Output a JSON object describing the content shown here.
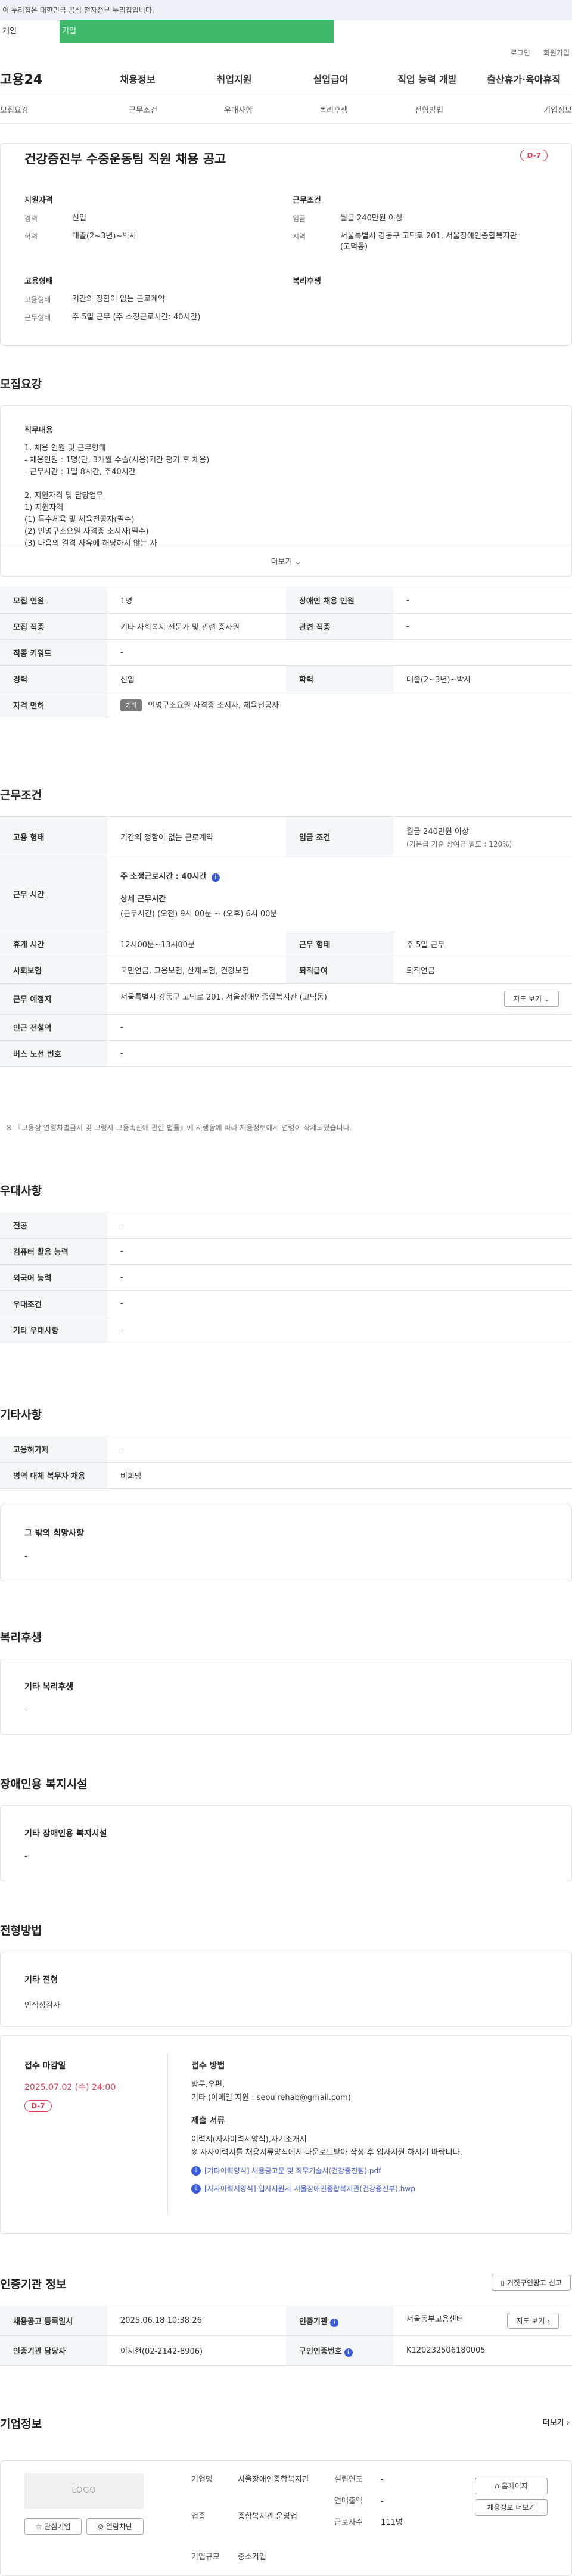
{
  "gov_banner": "이 누리집은 대한민국 공식 전자정부 누리집입니다.",
  "top_tabs": [
    "개인",
    "기업"
  ],
  "util_links": [
    "로그인",
    "회원가입"
  ],
  "brand": "고용24",
  "gnb": [
    "채용정보",
    "취업지원",
    "실업급여",
    "직업 능력 개발",
    "출산휴가·육아휴직"
  ],
  "anchors": [
    "모집요강",
    "근무조건",
    "우대사항",
    "복리후생",
    "전형방법",
    "기업정보"
  ],
  "summary": {
    "title": "건강증진부 수중운동팀 직원 채용 공고",
    "dday": "D-7",
    "qual_h": "지원자격",
    "career_k": "경력",
    "career_v": "신입",
    "edu_k": "학력",
    "edu_v": "대졸(2~3년)~박사",
    "cond_h": "근무조건",
    "wage_k": "임금",
    "wage_v": "월급 240만원 이상",
    "area_k": "지역",
    "area_v": "서울특별시 강동구 고덕로 201, 서울장애인종합복지관 (고덕동)",
    "emp_h": "고용형태",
    "emp_k": "고용형태",
    "emp_v": "기간의 정함이 없는 근로계약",
    "type_k": "근무형태",
    "type_v": "주 5일 근무 (주 소정근로시간: 40시간)",
    "welfare_h": "복리후생"
  },
  "recruit": {
    "title": "모집요강",
    "desc_label": "직무내용",
    "desc_lines": [
      "1. 채용 인원 및 근무형태",
      "- 채용인원 : 1명(단, 3개월 수습(시용)기간 평가 후 채용)",
      "- 근무시간 : 1일 8시간, 주40시간",
      "",
      "2. 지원자격 및 담당업무",
      "1) 지원자격",
      "(1) 특수체육 및 체육전공자(필수)",
      "(2) 인명구조요원 자격증 소지자(필수)",
      "(3) 다음의 결격 사유에 해당하지 않는 자"
    ],
    "more": "더보기",
    "rows": [
      {
        "k": "모집 인원",
        "v": "1명",
        "k2": "장애인 채용 인원",
        "v2": "-"
      },
      {
        "k": "모집 직종",
        "v": "기타 사회복지 전문가 및 관련 종사원",
        "k2": "관련 직종",
        "v2": "-"
      },
      {
        "k": "직종 키워드",
        "v": "-"
      },
      {
        "k": "경력",
        "v": "신입",
        "k2": "학력",
        "v2": "대졸(2~3년)~박사"
      }
    ],
    "license_k": "자격 면허",
    "license_badge": "기타",
    "license_v": "인명구조요원 자격증 소지자, 체육전공자"
  },
  "work": {
    "title": "근무조건",
    "emp_k": "고용 형태",
    "emp_v": "기간의 정함이 없는 근로계약",
    "wage_k": "임금 조건",
    "wage_v": "월급 240만원 이상",
    "wage_sub": "(기본급 기준 상여금 별도 : 120%)",
    "hours_k": "근무 시간",
    "hours_total": "주 소정근로시간 : 40시간",
    "hours_detail_h": "상세 근무시간",
    "hours_detail": "(근무시간) (오전) 9시 00분 ~ (오후) 6시 00분",
    "rest_k": "휴게 시간",
    "rest_v": "12시00분~13시00분",
    "type_k": "근무 형태",
    "type_v": "주 5일 근무",
    "ins_k": "사회보험",
    "ins_v": "국민연금, 고용보험, 산재보험, 건강보험",
    "ret_k": "퇴직급여",
    "ret_v": "퇴직연금",
    "place_k": "근무 예정지",
    "place_v": "서울특별시 강동구 고덕로 201, 서울장애인종합복지관 (고덕동)",
    "map_btn": "지도 보기",
    "subway_k": "인근 전철역",
    "subway_v": "-",
    "bus_k": "버스 노선 번호",
    "bus_v": "-",
    "note": "※ 『고용상 연령차별금지 및 고령자 고용촉진에 관한 법률』에 시행함에 따라 채용정보에서 연령이 삭제되었습니다."
  },
  "pref": {
    "title": "우대사항",
    "rows": [
      {
        "k": "전공",
        "v": "-"
      },
      {
        "k": "컴퓨터 활용 능력",
        "v": "-"
      },
      {
        "k": "외국어 능력",
        "v": "-"
      },
      {
        "k": "우대조건",
        "v": "-"
      },
      {
        "k": "기타 우대사항",
        "v": "-"
      }
    ]
  },
  "etc": {
    "title": "기타사항",
    "rows": [
      {
        "k": "고용허가제",
        "v": "-"
      },
      {
        "k": "병역 대체 복무자 채용",
        "v": "비희망"
      }
    ],
    "other_h": "그 밖의 희망사항",
    "other_v": "-"
  },
  "welfare": {
    "title": "복리후생",
    "h": "기타 복리후생",
    "v": "-"
  },
  "disabled": {
    "title": "장애인용 복지시설",
    "h": "기타 장애인용 복지시설",
    "v": "-"
  },
  "selection": {
    "title": "전형방법",
    "h": "기타 전형",
    "v": "인적성검사"
  },
  "apply": {
    "deadline_h": "접수 마감일",
    "deadline_v": "2025.07.02 (수) 24:00",
    "dday": "D-7",
    "method_h": "접수 방법",
    "method_v1": "방문,우편,",
    "method_v2": "기타 (이메일 지원 : seoulrehab@gmail.com)",
    "docs_h": "제출 서류",
    "docs_v1": "이력서(자사이력서양식),자기소개서",
    "docs_v2": "※ 자사이력서를 채용서류양식에서 다운로드받아 작성 후 입사지원 하시기 바랍니다.",
    "file1": "[기타이력양식] 채용공고문 및 직무기술서(건강증진팀).pdf",
    "file2": "[자사이력서양식] 입사지원서-서울장애인종합복지관(건강증진부).hwp"
  },
  "agency": {
    "title": "인증기관 정보",
    "report_btn": "거짓구인광고 신고",
    "reg_k": "채용공고 등록일시",
    "reg_v": "2025.06.18 10:38:26",
    "org_k": "인증기관",
    "org_v": "서울동부고용센터",
    "map_btn": "지도 보기",
    "mgr_k": "인증기관 담당자",
    "mgr_v": "이지현(02-2142-8906)",
    "no_k": "구인인증번호",
    "no_v": "K120232506180005"
  },
  "company": {
    "title": "기업정보",
    "more": "더보기",
    "logo": "LOGO",
    "fav_btn": "관심기업",
    "block_btn": "열람차단",
    "name_k": "기업명",
    "name_v": "서울장애인종합복지관",
    "found_k": "설립연도",
    "found_v": "-",
    "ind_k": "업종",
    "ind_v": "종합복지관 운영업",
    "sales_k": "연매출액",
    "sales_v": "-",
    "emp_k": "근로자수",
    "emp_v": "111명",
    "size_k": "기업규모",
    "size_v": "중소기업",
    "home_btn": "홈페이지",
    "info_btn": "채용정보 더보기"
  }
}
